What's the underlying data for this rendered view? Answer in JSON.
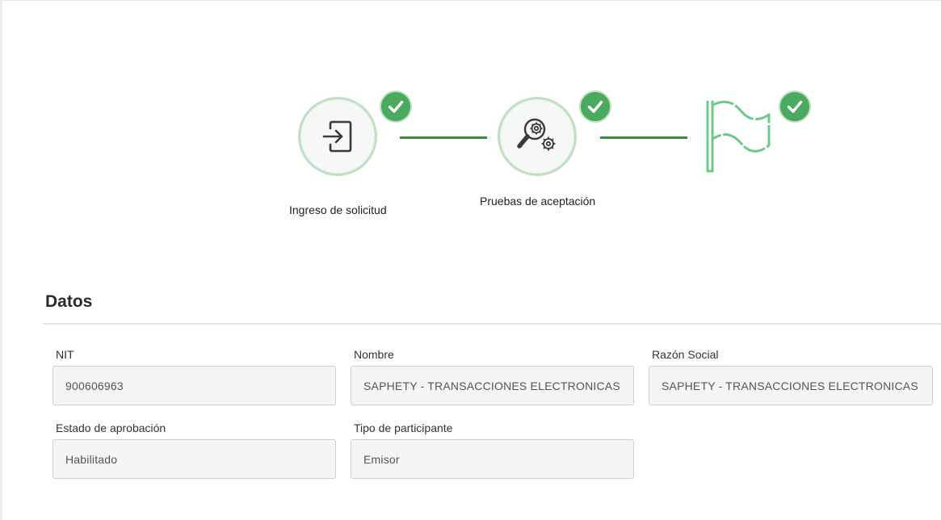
{
  "stepper": {
    "steps": [
      {
        "label": "Ingreso de solicitud",
        "icon": "login-arrow-icon",
        "status": "completed"
      },
      {
        "label": "Pruebas de aceptación",
        "icon": "search-gears-icon",
        "status": "completed"
      },
      {
        "label": "",
        "icon": "finish-flag-icon",
        "status": "completed"
      }
    ],
    "colors": {
      "check": "#4caa5e",
      "connector": "#3b8a45",
      "ring": "#bfe0c5",
      "flag": "#6cc98a"
    }
  },
  "datos": {
    "title": "Datos",
    "fields": {
      "nit": {
        "label": "NIT",
        "value": "900606963"
      },
      "nombre": {
        "label": "Nombre",
        "value": "SAPHETY - TRANSACCIONES ELECTRONICAS"
      },
      "razon_social": {
        "label": "Razón Social",
        "value": "SAPHETY - TRANSACCIONES ELECTRONICAS"
      },
      "estado": {
        "label": "Estado de aprobación",
        "value": "Habilitado"
      },
      "tipo": {
        "label": "Tipo de participante",
        "value": "Emisor"
      }
    }
  }
}
